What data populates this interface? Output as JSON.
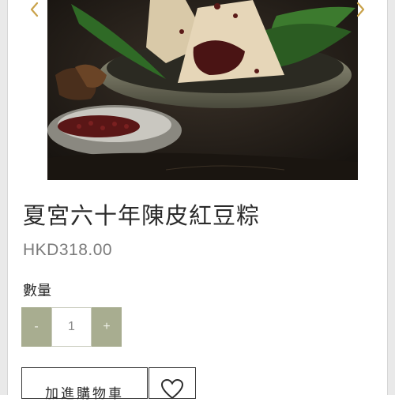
{
  "product": {
    "title": "夏宮六十年陳皮紅豆粽",
    "price": "HKD318.00"
  },
  "quantity": {
    "label": "數量",
    "decrement_label": "-",
    "value": "1",
    "increment_label": "+"
  },
  "actions": {
    "add_to_cart_label": "加進購物車"
  },
  "icons": {
    "prev": "chevron-left-icon",
    "next": "chevron-right-icon",
    "wishlist": "heart-icon"
  },
  "colors": {
    "arrow": "#c9a24a",
    "qty_button_bg": "#a8ad90",
    "border": "#3a3a3a"
  }
}
